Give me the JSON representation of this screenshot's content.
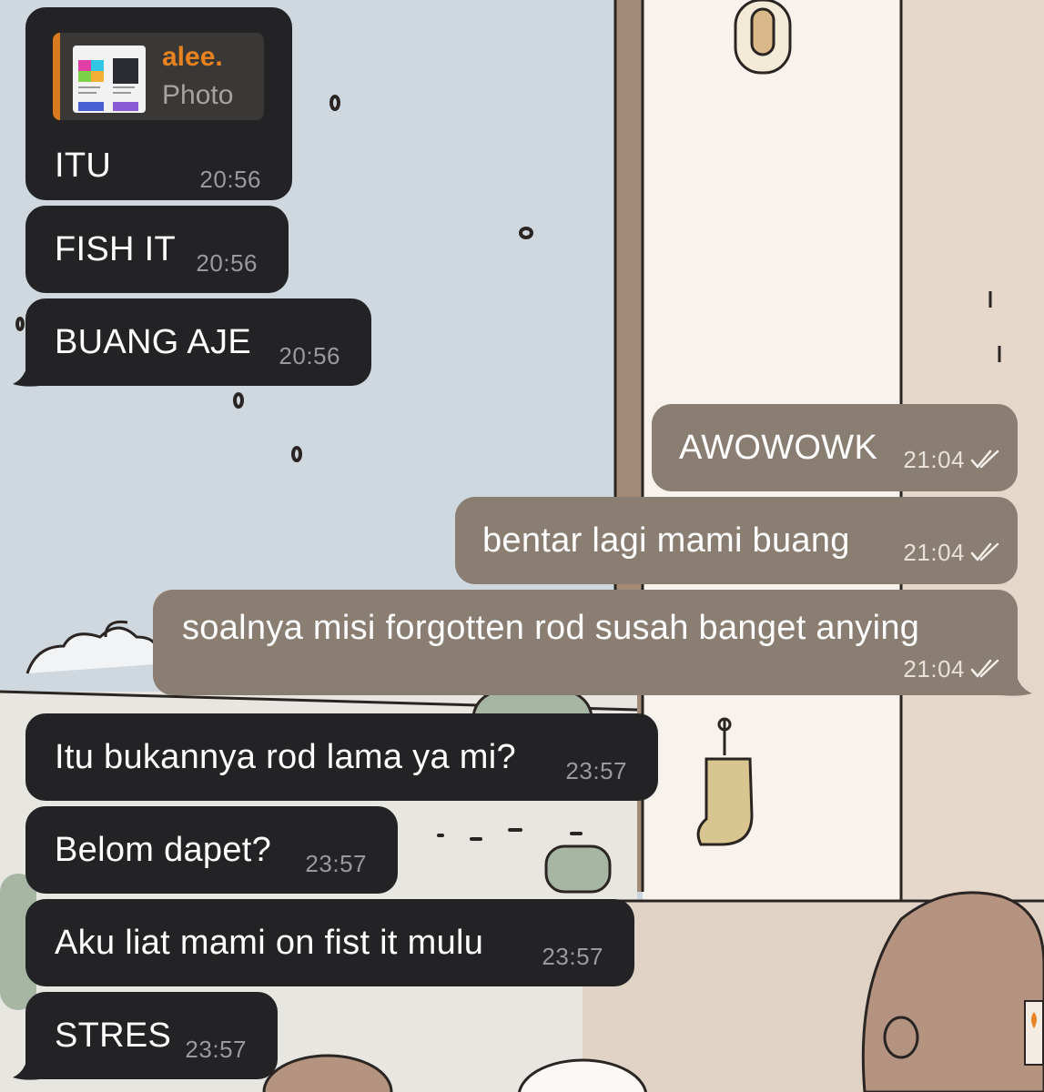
{
  "colors": {
    "incoming_bubble": "#232325",
    "outgoing_bubble": "#8a7d72",
    "reply_accent": "#d97a1e",
    "reply_name": "#e8821f"
  },
  "reply_preview": {
    "sender": "alee.",
    "label": "Photo"
  },
  "messages": [
    {
      "direction": "incoming",
      "text": "ITU",
      "time": "20:56",
      "has_reply_preview": true
    },
    {
      "direction": "incoming",
      "text": "FISH IT",
      "time": "20:56"
    },
    {
      "direction": "incoming",
      "text": "BUANG AJE",
      "time": "20:56"
    },
    {
      "direction": "outgoing",
      "text": "AWOWOWK",
      "time": "21:04",
      "status": "read-double-check"
    },
    {
      "direction": "outgoing",
      "text": "bentar lagi mami buang",
      "time": "21:04",
      "status": "read-double-check"
    },
    {
      "direction": "outgoing",
      "text": "soalnya misi forgotten rod susah banget anying",
      "time": "21:04",
      "status": "read-double-check"
    },
    {
      "direction": "incoming",
      "text": "Itu bukannya rod lama ya mi?",
      "time": "23:57"
    },
    {
      "direction": "incoming",
      "text": "Belom dapet?",
      "time": "23:57"
    },
    {
      "direction": "incoming",
      "text": "Aku liat mami on fist it mulu",
      "time": "23:57"
    },
    {
      "direction": "incoming",
      "text": "STRES",
      "time": "23:57"
    }
  ]
}
